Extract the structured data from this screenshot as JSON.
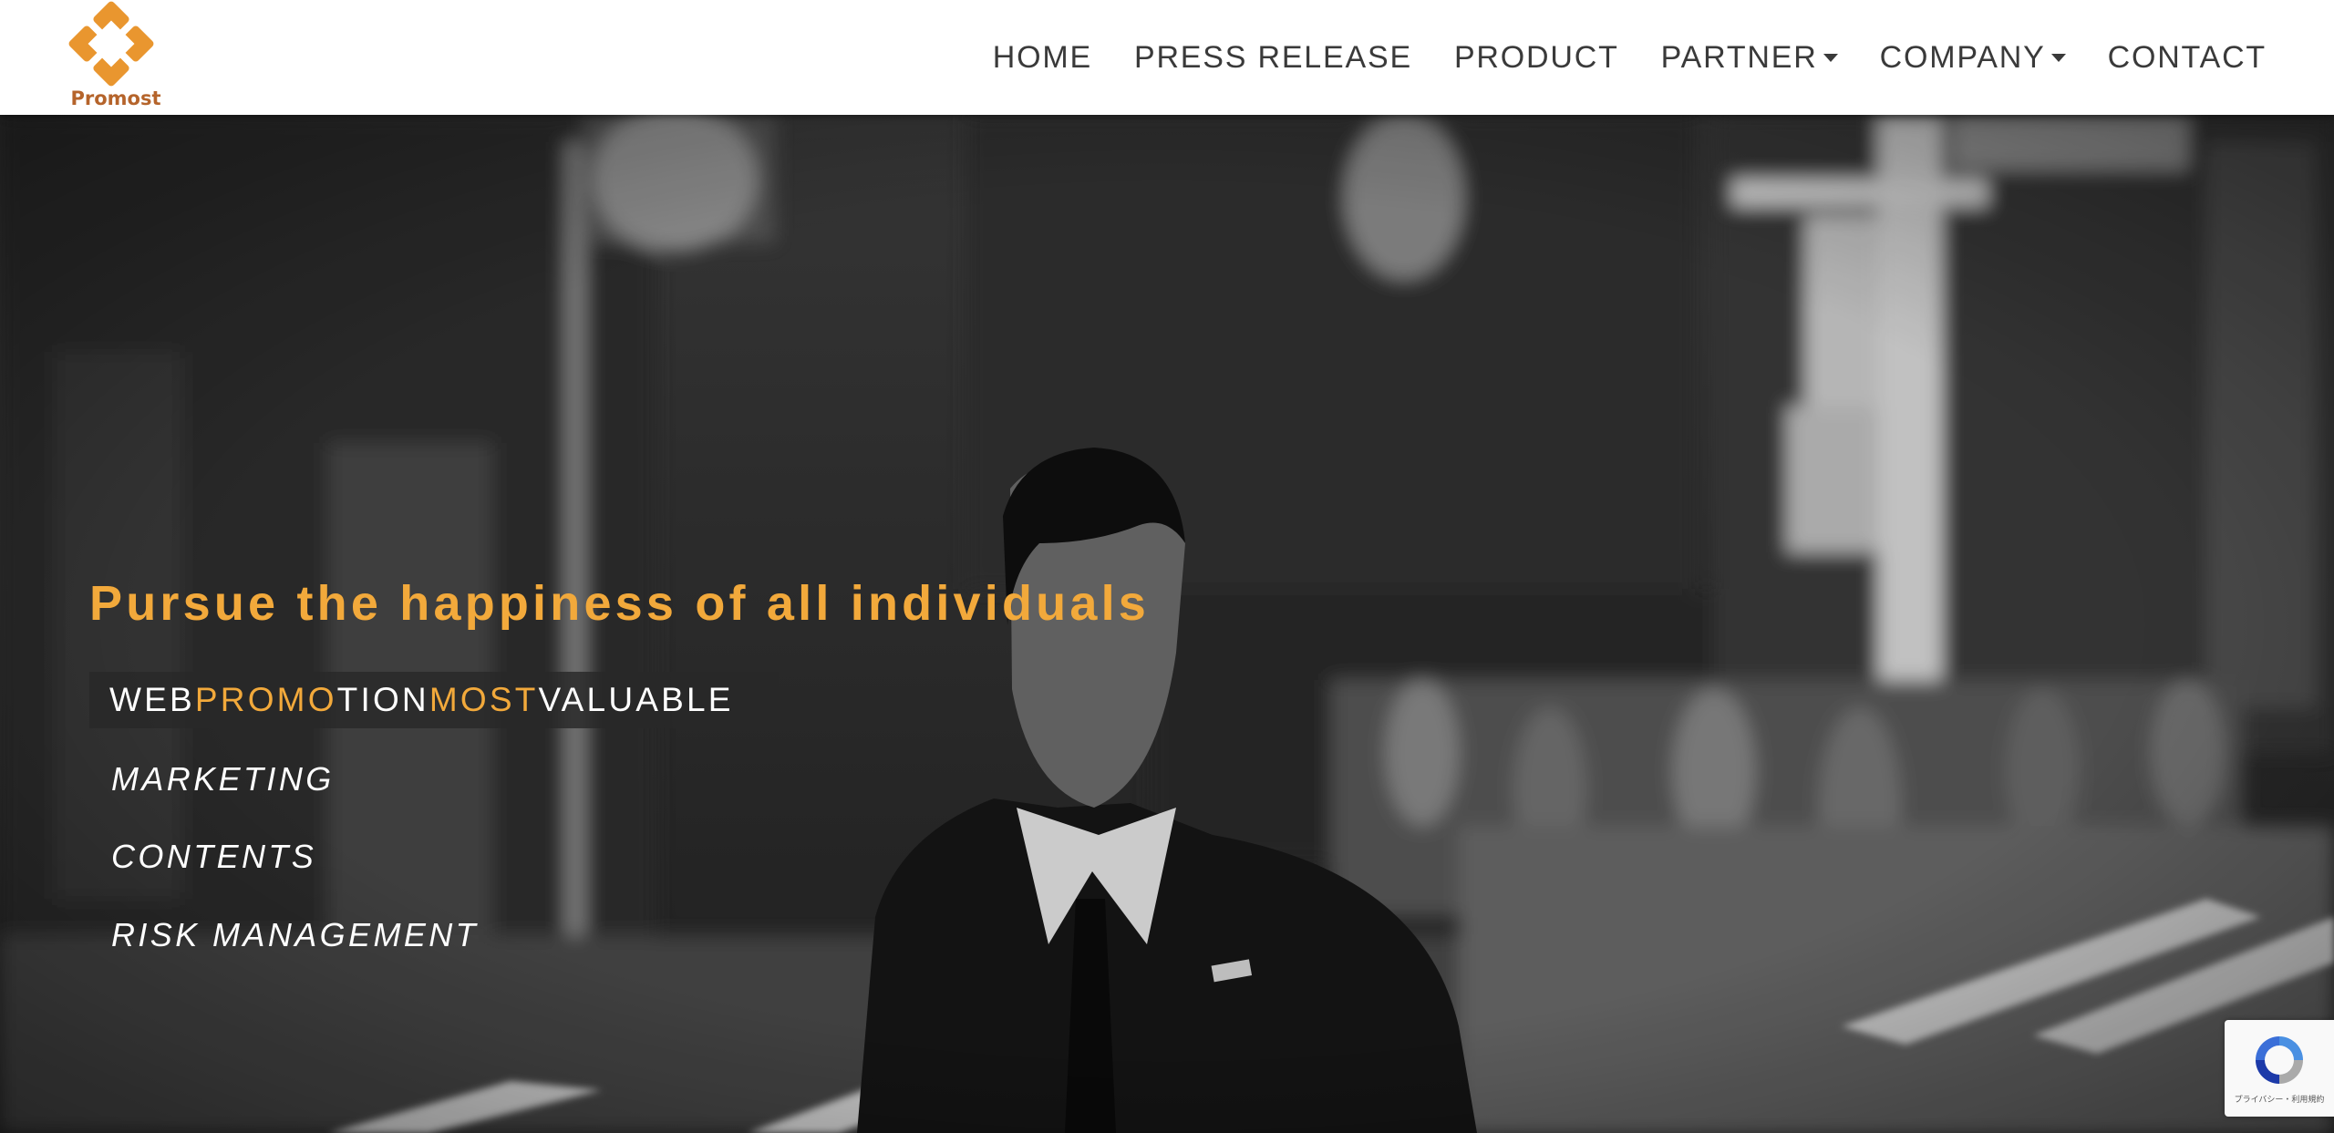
{
  "header": {
    "logo_text": "Promost",
    "nav": [
      {
        "label": "HOME",
        "dropdown": false
      },
      {
        "label": "PRESS RELEASE",
        "dropdown": false
      },
      {
        "label": "PRODUCT",
        "dropdown": false
      },
      {
        "label": "PARTNER",
        "dropdown": true
      },
      {
        "label": "COMPANY",
        "dropdown": true
      },
      {
        "label": "CONTACT",
        "dropdown": false
      }
    ]
  },
  "hero": {
    "tagline": "Pursue the happiness of all individuals",
    "brand": {
      "parts": [
        "WEB ",
        "PROMO",
        "TION ",
        "MOST",
        " VALUABLE"
      ]
    },
    "services": [
      "MARKETING",
      "CONTENTS",
      "RISK MANAGEMENT"
    ]
  },
  "recaptcha": {
    "text": "プライバシー・利用規約"
  },
  "colors": {
    "accent": "#f2a93b",
    "logo_orange": "#e9962f",
    "logo_text": "#b5642b",
    "nav_text": "#3a3a3a",
    "white": "#ffffff"
  },
  "icons": {
    "logo": "promost-diamond-logo",
    "caret": "caret-down-icon",
    "recaptcha": "recaptcha-icon"
  }
}
